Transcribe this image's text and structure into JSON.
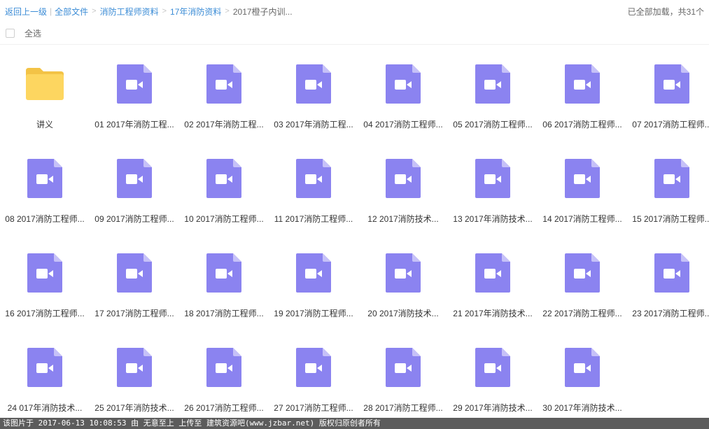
{
  "breadcrumb": {
    "back": "返回上一级",
    "items": [
      "全部文件",
      "消防工程师资料",
      "17年消防资料"
    ],
    "current": "2017橙子内训..."
  },
  "status": {
    "loaded_text": "已全部加载，共31个"
  },
  "select_all": {
    "label": "全选"
  },
  "colors": {
    "video": "#8b83f0",
    "video_fold": "#c6c1f8",
    "folder": "#fdd660",
    "folder_tab": "#f3c346",
    "link": "#3b8cd6"
  },
  "files": [
    {
      "name": "讲义",
      "type": "folder",
      "icon": "folder-icon"
    },
    {
      "name": "01 2017年消防工程...",
      "type": "video",
      "icon": "video-file-icon"
    },
    {
      "name": "02 2017年消防工程...",
      "type": "video",
      "icon": "video-file-icon"
    },
    {
      "name": "03 2017年消防工程...",
      "type": "video",
      "icon": "video-file-icon"
    },
    {
      "name": "04 2017消防工程师...",
      "type": "video",
      "icon": "video-file-icon"
    },
    {
      "name": "05 2017消防工程师...",
      "type": "video",
      "icon": "video-file-icon"
    },
    {
      "name": "06 2017消防工程师...",
      "type": "video",
      "icon": "video-file-icon"
    },
    {
      "name": "07 2017消防工程师...",
      "type": "video",
      "icon": "video-file-icon"
    },
    {
      "name": "08 2017消防工程师...",
      "type": "video",
      "icon": "video-file-icon"
    },
    {
      "name": "09 2017消防工程师...",
      "type": "video",
      "icon": "video-file-icon"
    },
    {
      "name": "10 2017消防工程师...",
      "type": "video",
      "icon": "video-file-icon"
    },
    {
      "name": "11 2017消防工程师...",
      "type": "video",
      "icon": "video-file-icon"
    },
    {
      "name": "12 2017消防技术...",
      "type": "video",
      "icon": "video-file-icon"
    },
    {
      "name": "13 2017年消防技术...",
      "type": "video",
      "icon": "video-file-icon"
    },
    {
      "name": "14 2017消防工程师...",
      "type": "video",
      "icon": "video-file-icon"
    },
    {
      "name": "15 2017消防工程师...",
      "type": "video",
      "icon": "video-file-icon"
    },
    {
      "name": "16 2017消防工程师...",
      "type": "video",
      "icon": "video-file-icon"
    },
    {
      "name": "17 2017消防工程师...",
      "type": "video",
      "icon": "video-file-icon"
    },
    {
      "name": "18 2017消防工程师...",
      "type": "video",
      "icon": "video-file-icon"
    },
    {
      "name": "19 2017消防工程师...",
      "type": "video",
      "icon": "video-file-icon"
    },
    {
      "name": "20 2017消防技术...",
      "type": "video",
      "icon": "video-file-icon"
    },
    {
      "name": "21 2017年消防技术...",
      "type": "video",
      "icon": "video-file-icon"
    },
    {
      "name": "22 2017消防工程师...",
      "type": "video",
      "icon": "video-file-icon"
    },
    {
      "name": "23 2017消防工程师...",
      "type": "video",
      "icon": "video-file-icon"
    },
    {
      "name": "24 017年消防技术...",
      "type": "video",
      "icon": "video-file-icon"
    },
    {
      "name": "25 2017年消防技术...",
      "type": "video",
      "icon": "video-file-icon"
    },
    {
      "name": "26 2017消防工程师...",
      "type": "video",
      "icon": "video-file-icon"
    },
    {
      "name": "27 2017消防工程师...",
      "type": "video",
      "icon": "video-file-icon"
    },
    {
      "name": "28 2017消防工程师...",
      "type": "video",
      "icon": "video-file-icon"
    },
    {
      "name": "29 2017年消防技术...",
      "type": "video",
      "icon": "video-file-icon"
    },
    {
      "name": "30 2017年消防技术...",
      "type": "video",
      "icon": "video-file-icon"
    }
  ],
  "watermark": {
    "text": "该图片于 2017-06-13 10:08:53 由 无意至上 上传至 建筑资源吧(www.jzbar.net) 版权归原创者所有"
  }
}
